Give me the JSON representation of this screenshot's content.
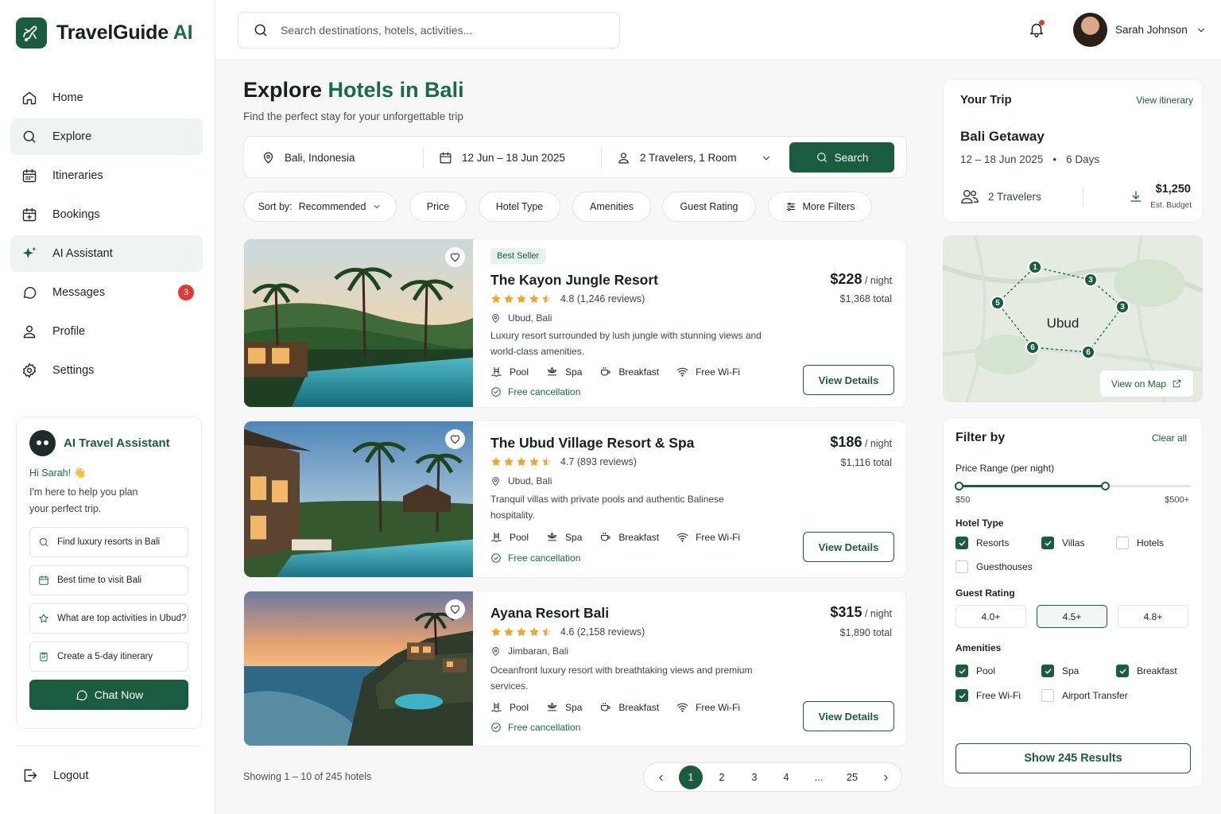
{
  "brand": {
    "name": "TravelGuide",
    "suffix": "AI"
  },
  "nav": [
    {
      "label": "Home",
      "icon": "home-icon"
    },
    {
      "label": "Explore",
      "icon": "search-icon",
      "active": true
    },
    {
      "label": "Itineraries",
      "icon": "calendar-icon"
    },
    {
      "label": "Bookings",
      "icon": "calendar-plus-icon"
    },
    {
      "label": "AI Assistant",
      "icon": "sparkle-icon",
      "active": true
    },
    {
      "label": "Messages",
      "icon": "chat-icon",
      "badge": "3"
    },
    {
      "label": "Profile",
      "icon": "user-icon"
    },
    {
      "label": "Settings",
      "icon": "gear-icon"
    }
  ],
  "assistant": {
    "title": "AI Travel Assistant",
    "greeting": "Hi Sarah! 👋",
    "body": "I'm here to help you plan your perfect trip.",
    "options": [
      {
        "label": "Find luxury resorts in Bali",
        "icon": "search-icon"
      },
      {
        "label": "Best time to visit Bali",
        "icon": "calendar-icon"
      },
      {
        "label": "What are top activities in Ubud?",
        "icon": "star-icon"
      },
      {
        "label": "Create a 5-day itinerary",
        "icon": "clipboard-icon"
      }
    ],
    "chat_label": "Chat Now"
  },
  "logout_label": "Logout",
  "search": {
    "placeholder": "Search destinations, hotels, activities..."
  },
  "user": {
    "name": "Sarah Johnson"
  },
  "page": {
    "title_prefix": "Explore ",
    "title_highlight": "Hotels in Bali",
    "subtitle": "Find the perfect stay for your unforgettable trip"
  },
  "searchbar": {
    "location": "Bali, Indonesia",
    "dates": "12 Jun – 18 Jun 2025",
    "guests": "2 Travelers, 1 Room",
    "button": "Search"
  },
  "filters_chips": {
    "sort_prefix": "Sort by:",
    "sort_value": "Recommended",
    "price": "Price",
    "hotel_type": "Hotel Type",
    "amenities": "Amenities",
    "guest_rating": "Guest Rating",
    "more": "More Filters"
  },
  "hotels": [
    {
      "badge": "Best Seller",
      "name": "The Kayon Jungle Resort",
      "rating": "4.8",
      "reviews": "(1,246 reviews)",
      "location": "Ubud, Bali",
      "desc": "Luxury resort surrounded by lush jungle with stunning views and world-class amenities.",
      "price": "$228",
      "per": "/ night",
      "total": "$1,368 total",
      "free": "Free cancellation",
      "cta": "View Details",
      "stars": 4.5
    },
    {
      "badge": "",
      "name": "The Ubud Village Resort & Spa",
      "rating": "4.7",
      "reviews": "(893 reviews)",
      "location": "Ubud, Bali",
      "desc": "Tranquil villas with private pools and authentic Balinese hospitality.",
      "price": "$186",
      "per": "/ night",
      "total": "$1,116 total",
      "free": "Free cancellation",
      "cta": "View Details",
      "stars": 4.5
    },
    {
      "badge": "",
      "name": "Ayana Resort Bali",
      "rating": "4.6",
      "reviews": "(2,158 reviews)",
      "location": "Jimbaran, Bali",
      "desc": "Oceanfront luxury resort with breathtaking views and premium services.",
      "price": "$315",
      "per": "/ night",
      "total": "$1,890 total",
      "free": "Free cancellation",
      "cta": "View Details",
      "stars": 4.5
    }
  ],
  "amenity_labels": {
    "pool": "Pool",
    "spa": "Spa",
    "breakfast": "Breakfast",
    "wifi": "Free Wi-Fi"
  },
  "pagination": {
    "showing": "Showing 1 – 10 of 245 hotels",
    "pages": [
      "1",
      "2",
      "3",
      "4",
      "...",
      "25"
    ],
    "current": "1"
  },
  "trip": {
    "heading": "Your Trip",
    "link": "View itinerary",
    "name": "Bali Getaway",
    "dates": "12 – 18 Jun 2025",
    "sep": "•",
    "days": "6 Days",
    "travelers": "2 Travelers",
    "budget": "$1,250",
    "budget_label": "Est. Budget"
  },
  "map": {
    "label": "Ubud",
    "markers": [
      "1",
      "3",
      "3",
      "6",
      "6",
      "5"
    ],
    "button": "View on Map"
  },
  "filter": {
    "heading": "Filter by",
    "clear": "Clear all",
    "price_label": "Price Range (per night)",
    "price_min": "$50",
    "price_max": "$500+",
    "price_selected_fraction": 0.63,
    "hotel_type_label": "Hotel Type",
    "hotel_types": [
      {
        "label": "Resorts",
        "checked": true
      },
      {
        "label": "Villas",
        "checked": true
      },
      {
        "label": "Hotels",
        "checked": false
      },
      {
        "label": "Guesthouses",
        "checked": false
      }
    ],
    "guest_rating_label": "Guest Rating",
    "guest_ratings": [
      {
        "label": "4.0+",
        "selected": false
      },
      {
        "label": "4.5+",
        "selected": true
      },
      {
        "label": "4.8+",
        "selected": false
      }
    ],
    "amenities_label": "Amenities",
    "amenities": [
      {
        "label": "Pool",
        "checked": true
      },
      {
        "label": "Spa",
        "checked": true
      },
      {
        "label": "Breakfast",
        "checked": true
      },
      {
        "label": "Free Wi-Fi",
        "checked": true
      },
      {
        "label": "Airport Transfer",
        "checked": false
      }
    ],
    "show_button": "Show 245 Results"
  },
  "colors": {
    "brand": "#1a5c40",
    "accent": "#1a6b47",
    "badge": "#e03b35",
    "star": "#f5a623"
  }
}
